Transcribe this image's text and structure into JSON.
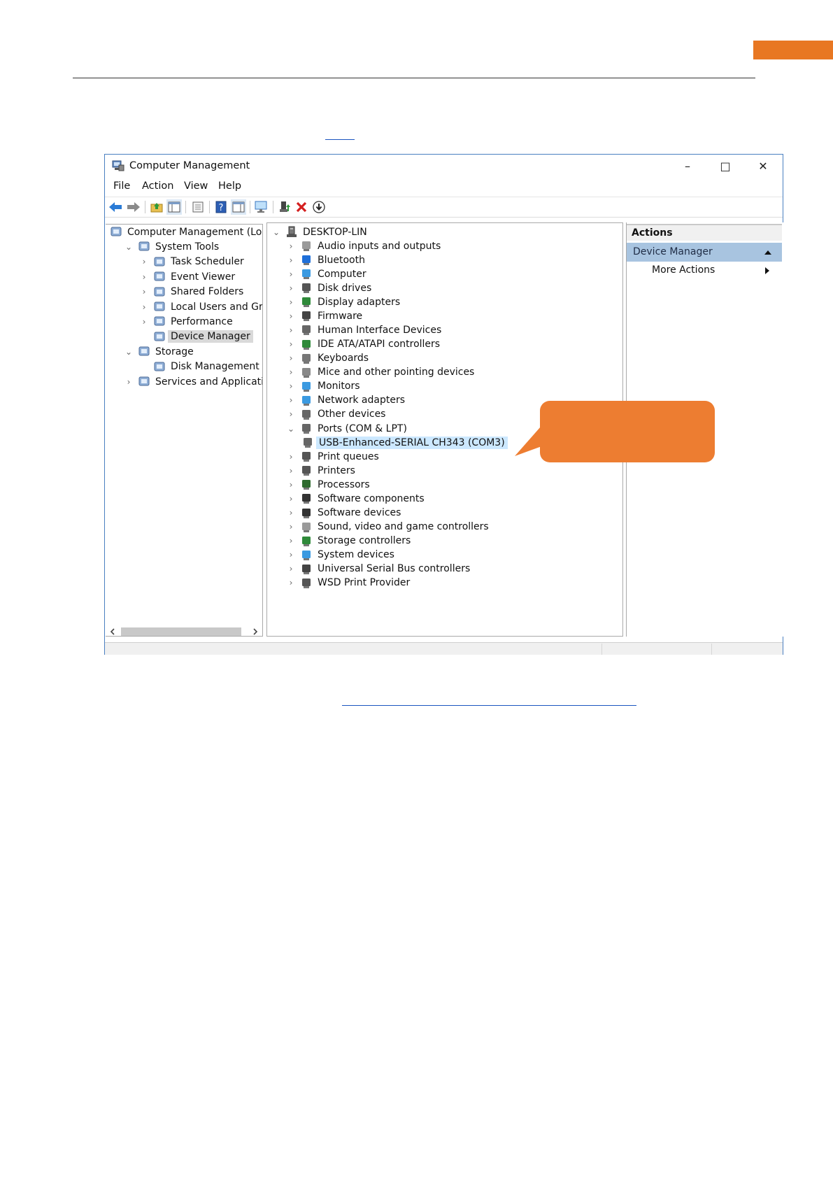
{
  "window": {
    "title": "Computer Management",
    "minimize_glyph": "–",
    "maximize_glyph": "□",
    "close_glyph": "✕"
  },
  "menu": [
    "File",
    "Action",
    "View",
    "Help"
  ],
  "toolbar_icons": [
    "back-arrow-icon",
    "forward-arrow-icon",
    "up-folder-icon",
    "show-hide-tree-icon",
    "properties-icon",
    "help-icon",
    "view-icon",
    "monitor-icon",
    "update-driver-icon",
    "uninstall-icon",
    "disable-device-icon"
  ],
  "left_tree": [
    {
      "label": "Computer Management (Local",
      "icon": "computer-management-icon",
      "chevron": ""
    },
    {
      "label": "System Tools",
      "icon": "system-tools-icon",
      "chevron": "v"
    },
    {
      "label": "Task Scheduler",
      "icon": "clock-icon",
      "chevron": ">"
    },
    {
      "label": "Event Viewer",
      "icon": "event-viewer-icon",
      "chevron": ">"
    },
    {
      "label": "Shared Folders",
      "icon": "shared-folders-icon",
      "chevron": ">"
    },
    {
      "label": "Local Users and Groups",
      "icon": "users-icon",
      "chevron": ">"
    },
    {
      "label": "Performance",
      "icon": "performance-icon",
      "chevron": ">"
    },
    {
      "label": "Device Manager",
      "icon": "device-manager-icon",
      "chevron": "",
      "selected": true
    },
    {
      "label": "Storage",
      "icon": "storage-icon",
      "chevron": "v"
    },
    {
      "label": "Disk Management",
      "icon": "disk-management-icon",
      "chevron": ""
    },
    {
      "label": "Services and Applications",
      "icon": "services-icon",
      "chevron": ">"
    }
  ],
  "device_tree": {
    "root": "DESKTOP-LIN",
    "items": [
      {
        "label": "Audio inputs and outputs",
        "icon": "speaker-icon",
        "color": "#9a9a9a"
      },
      {
        "label": "Bluetooth",
        "icon": "bluetooth-icon",
        "color": "#1e6fd9"
      },
      {
        "label": "Computer",
        "icon": "computer-icon",
        "color": "#3b9ae1"
      },
      {
        "label": "Disk drives",
        "icon": "disk-drive-icon",
        "color": "#555555"
      },
      {
        "label": "Display adapters",
        "icon": "display-adapter-icon",
        "color": "#2f8a3a"
      },
      {
        "label": "Firmware",
        "icon": "firmware-icon",
        "color": "#444444"
      },
      {
        "label": "Human Interface Devices",
        "icon": "hid-icon",
        "color": "#666666"
      },
      {
        "label": "IDE ATA/ATAPI controllers",
        "icon": "ide-controller-icon",
        "color": "#2f8a3a"
      },
      {
        "label": "Keyboards",
        "icon": "keyboard-icon",
        "color": "#777777"
      },
      {
        "label": "Mice and other pointing devices",
        "icon": "mouse-icon",
        "color": "#888888"
      },
      {
        "label": "Monitors",
        "icon": "monitor-icon",
        "color": "#3b9ae1"
      },
      {
        "label": "Network adapters",
        "icon": "network-adapter-icon",
        "color": "#3b9ae1"
      },
      {
        "label": "Other devices",
        "icon": "other-devices-icon",
        "color": "#666666"
      },
      {
        "label": "Ports (COM & LPT)",
        "icon": "port-icon",
        "color": "#666666",
        "expanded": true
      },
      {
        "label": "USB-Enhanced-SERIAL CH343 (COM3)",
        "icon": "serial-port-icon",
        "color": "#666666",
        "child": true,
        "selected": true
      },
      {
        "label": "Print queues",
        "icon": "print-queue-icon",
        "color": "#555555"
      },
      {
        "label": "Printers",
        "icon": "printer-icon",
        "color": "#555555"
      },
      {
        "label": "Processors",
        "icon": "processor-icon",
        "color": "#2f6b2f"
      },
      {
        "label": "Software components",
        "icon": "software-components-icon",
        "color": "#333333"
      },
      {
        "label": "Software devices",
        "icon": "software-devices-icon",
        "color": "#333333"
      },
      {
        "label": "Sound, video and game controllers",
        "icon": "sound-controller-icon",
        "color": "#9a9a9a"
      },
      {
        "label": "Storage controllers",
        "icon": "storage-controller-icon",
        "color": "#2f8a3a"
      },
      {
        "label": "System devices",
        "icon": "system-devices-icon",
        "color": "#3b9ae1"
      },
      {
        "label": "Universal Serial Bus controllers",
        "icon": "usb-icon",
        "color": "#444444"
      },
      {
        "label": "WSD Print Provider",
        "icon": "wsd-print-icon",
        "color": "#555555"
      }
    ]
  },
  "actions": {
    "header": "Actions",
    "section": "Device Manager",
    "more": "More Actions"
  },
  "colors": {
    "accent_orange": "#E87722",
    "callout": "#ED7D31",
    "selection_blue": "#cce8ff",
    "actions_section": "#a8c4e0"
  }
}
